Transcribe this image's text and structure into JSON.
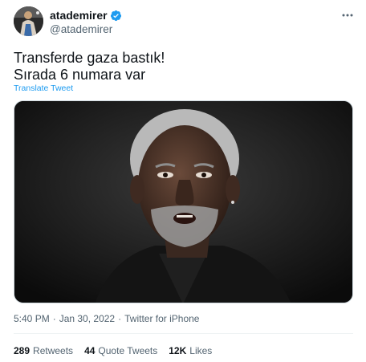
{
  "author": {
    "display_name": "atademirer",
    "handle": "@atademirer",
    "verified": true
  },
  "tweet": {
    "lines": [
      "Transferde gaza bastık!",
      "Sırada 6 numara var"
    ],
    "translate_label": "Translate Tweet"
  },
  "meta": {
    "time": "5:40 PM",
    "separator": "·",
    "date": "Jan 30, 2022",
    "separator2": "·",
    "source": "Twitter for iPhone"
  },
  "stats": {
    "retweets_count": "289",
    "retweets_label": "Retweets",
    "quotes_count": "44",
    "quotes_label": "Quote Tweets",
    "likes_count": "12K",
    "likes_label": "Likes"
  },
  "colors": {
    "accent": "#1d9bf0",
    "text": "#0f1419",
    "secondary": "#536471"
  },
  "icons": {
    "verified": "verified-badge-icon",
    "more": "more-options-icon"
  }
}
